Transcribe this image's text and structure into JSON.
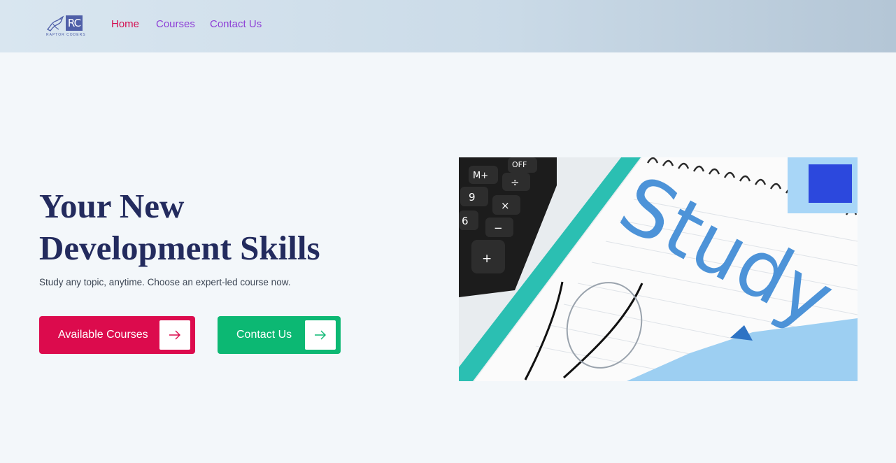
{
  "logo": {
    "mark": "RC",
    "subtitle": "RAPTOR CODERS"
  },
  "nav": {
    "items": [
      {
        "label": "Home",
        "active": true
      },
      {
        "label": "Courses",
        "active": false
      },
      {
        "label": "Contact Us",
        "active": false
      }
    ]
  },
  "hero": {
    "title_line1": "Your New",
    "title_line2": "Development Skills",
    "subtitle": "Study any topic, anytime. Choose an expert-led course now.",
    "primary_button": {
      "label": "Available Courses",
      "icon": "arrow-right-icon"
    },
    "secondary_button": {
      "label": "Contact Us",
      "icon": "arrow-right-icon"
    },
    "image": {
      "word": "Study",
      "calculator_keys": [
        "OFF",
        "M+",
        "÷",
        "9",
        "×",
        "6",
        "−",
        "+"
      ]
    }
  },
  "colors": {
    "brand": "#4f5fa8",
    "nav_active": "#d40d4f",
    "nav_link": "#8e3fd6",
    "title": "#232b5e",
    "primary_button": "#dc0b4d",
    "secondary_button": "#0cb873"
  }
}
